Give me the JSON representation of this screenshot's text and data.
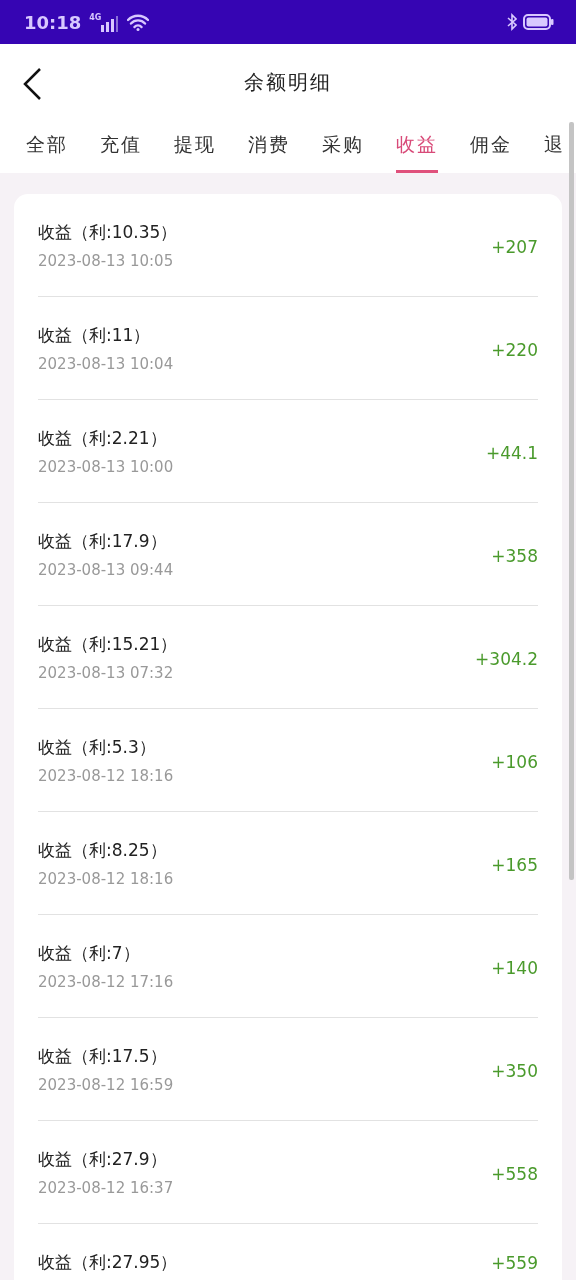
{
  "status_bar": {
    "time": "10:18",
    "network": "4G"
  },
  "header": {
    "title": "余额明细"
  },
  "tabs": [
    {
      "label": "全部",
      "selected": false
    },
    {
      "label": "充值",
      "selected": false
    },
    {
      "label": "提现",
      "selected": false
    },
    {
      "label": "消费",
      "selected": false
    },
    {
      "label": "采购",
      "selected": false
    },
    {
      "label": "收益",
      "selected": true
    },
    {
      "label": "佣金",
      "selected": false
    },
    {
      "label": "退",
      "selected": false
    }
  ],
  "records": [
    {
      "title": "收益（利:10.35）",
      "time": "2023-08-13 10:05",
      "amount": "+207"
    },
    {
      "title": "收益（利:11）",
      "time": "2023-08-13 10:04",
      "amount": "+220"
    },
    {
      "title": "收益（利:2.21）",
      "time": "2023-08-13 10:00",
      "amount": "+44.1"
    },
    {
      "title": "收益（利:17.9）",
      "time": "2023-08-13 09:44",
      "amount": "+358"
    },
    {
      "title": "收益（利:15.21）",
      "time": "2023-08-13 07:32",
      "amount": "+304.2"
    },
    {
      "title": "收益（利:5.3）",
      "time": "2023-08-12 18:16",
      "amount": "+106"
    },
    {
      "title": "收益（利:8.25）",
      "time": "2023-08-12 18:16",
      "amount": "+165"
    },
    {
      "title": "收益（利:7）",
      "time": "2023-08-12 17:16",
      "amount": "+140"
    },
    {
      "title": "收益（利:17.5）",
      "time": "2023-08-12 16:59",
      "amount": "+350"
    },
    {
      "title": "收益（利:27.9）",
      "time": "2023-08-12 16:37",
      "amount": "+558"
    },
    {
      "title": "收益（利:27.95）",
      "amount": "+559"
    }
  ]
}
